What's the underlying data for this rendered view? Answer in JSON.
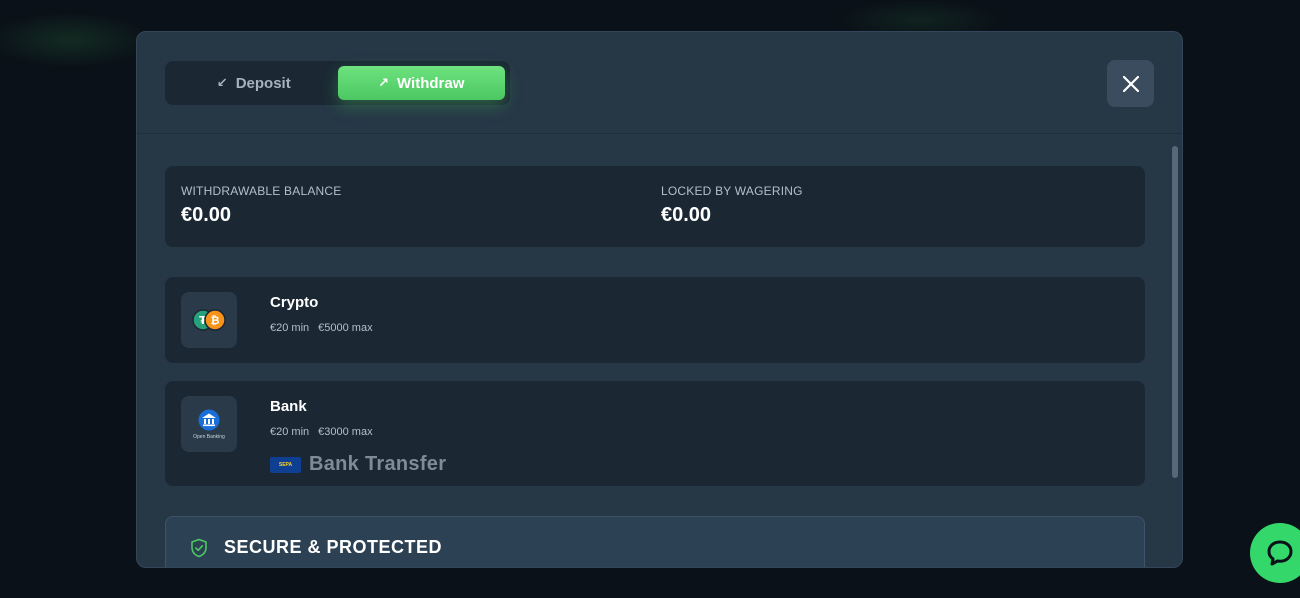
{
  "tabs": {
    "deposit": {
      "label": "Deposit",
      "arrow": "↙"
    },
    "withdraw": {
      "label": "Withdraw",
      "arrow": "↗"
    }
  },
  "balance": {
    "withdrawable_label": "WITHDRAWABLE BALANCE",
    "withdrawable_value": "€0.00",
    "locked_label": "LOCKED BY WAGERING",
    "locked_value": "€0.00"
  },
  "methods": [
    {
      "name": "Crypto",
      "min": "€20 min",
      "max": "€5000 max",
      "icon": "crypto-coins-icon"
    },
    {
      "name": "Bank",
      "min": "€20 min",
      "max": "€3000 max",
      "icon": "open-banking-icon",
      "icon_caption": "Open Banking",
      "sepa_badge": "SEPA",
      "sepa_label": "Bank Transfer"
    }
  ],
  "secure": {
    "title": "SECURE & PROTECTED"
  },
  "colors": {
    "accent": "#4cc862",
    "modal_bg": "#263746",
    "card_bg": "#1b2834",
    "chat_button": "#34d86a"
  }
}
